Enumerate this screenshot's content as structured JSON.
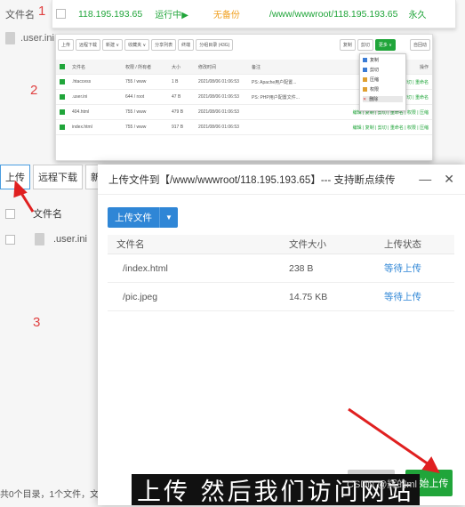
{
  "background": {
    "header_label": "文件名",
    "file_name": ".user.ini",
    "toolbar": {
      "upload": "上传",
      "remote_download": "远程下载",
      "new": "新"
    },
    "list_header": "文件名",
    "list_file": ".user.ini",
    "footer": "共0个目录，1个文件，文件"
  },
  "step_labels": [
    "1",
    "2",
    "3"
  ],
  "site_row": {
    "ip": "118.195.193.65",
    "status": "运行中▶",
    "backup": "无备份",
    "path": "/www/wwwroot/118.195.193.65",
    "expire": "永久"
  },
  "panel2": {
    "toolbar": [
      "上传",
      "远程下载",
      "新建 ∨",
      "收藏夹 ∨",
      "分享列表",
      "终端",
      "分组目录 (43G)"
    ],
    "right_buttons": [
      "复制",
      "剪切",
      "更多 ∨",
      "自回动"
    ],
    "columns": [
      "文件名",
      "权限 / 所有者",
      "大小",
      "修改时间",
      "备注",
      "操作"
    ],
    "rows": [
      {
        "name": ".htaccess",
        "perm": "755 / www",
        "size": "1 B",
        "mtime": "2021/08/06 01:06:53",
        "note": "PS: Apache用户配置...",
        "ops": "编辑 | 复制 | 剪切 | 重命名"
      },
      {
        "name": ".user.ini",
        "perm": "644 / root",
        "size": "47 B",
        "mtime": "2021/08/06 01:06:53",
        "note": "PS: PHP用户配置文件...",
        "ops": "编辑 | 复制 | 剪切 | 重命名"
      },
      {
        "name": "404.html",
        "perm": "755 / www",
        "size": "479 B",
        "mtime": "2021/08/06 01:06:53",
        "note": "",
        "ops": "编辑 | 复制 | 剪切 | 重命名 | 权限 | 压缩"
      },
      {
        "name": "index.html",
        "perm": "755 / www",
        "size": "917 B",
        "mtime": "2021/08/06 01:06:53",
        "note": "",
        "ops": "编辑 | 复制 | 剪切 | 重命名 | 权限 | 压缩"
      }
    ],
    "dropdown": [
      "复制",
      "剪切",
      "压缩",
      "权限",
      "删除"
    ]
  },
  "modal": {
    "title": "上传文件到【/www/wwwroot/118.195.193.65】--- 支持断点续传",
    "minimize": "—",
    "close": "✕",
    "upload_button": "上传文件",
    "columns": [
      "文件名",
      "文件大小",
      "上传状态"
    ],
    "files": [
      {
        "name": "/index.html",
        "size": "238 B",
        "status": "等待上传"
      },
      {
        "name": "/pic.jpeg",
        "size": "14.75 KB",
        "status": "等待上传"
      }
    ],
    "start_button": "开始上传"
  },
  "subtitle": "上传  然后我们访问网站",
  "watermark": "CSDN @辉的ml"
}
